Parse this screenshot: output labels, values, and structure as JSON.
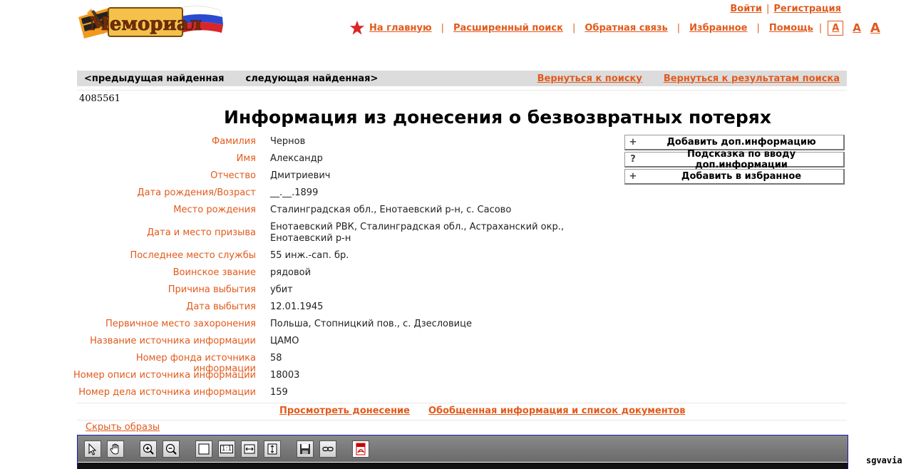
{
  "header": {
    "logo_text": "Мемориал",
    "auth": {
      "login": "Войти",
      "register": "Регистрация",
      "sep": "|"
    },
    "nav": [
      {
        "label": "На главную"
      },
      {
        "label": "Расширенный поиск"
      },
      {
        "label": "Обратная связь"
      },
      {
        "label": "Избранное"
      },
      {
        "label": "Помощь"
      }
    ],
    "nav_sep": "|",
    "font_sizes": [
      "А",
      "А",
      "А"
    ]
  },
  "navbar": {
    "prev": "<предыдущая найденная",
    "next": "следующая найденная>",
    "back_to_search": "Вернуться к поиску",
    "back_to_results": "Вернуться к результатам поиска"
  },
  "record_id": "4085561",
  "title": "Информация из донесения о безвозвратных потерях",
  "fields": [
    {
      "label": "Фамилия",
      "value": "Чернов"
    },
    {
      "label": "Имя",
      "value": "Александр"
    },
    {
      "label": "Отчество",
      "value": "Дмитриевич"
    },
    {
      "label": "Дата рождения/Возраст",
      "value": "__.__.1899"
    },
    {
      "label": "Место рождения",
      "value": "Сталинградская обл., Енотаевский р-н, с. Сасово"
    },
    {
      "label": "Дата и место призыва",
      "value": "Енотаевский РВК, Сталинградская обл., Астраханский окр., Енотаевский р-н"
    },
    {
      "label": "Последнее место службы",
      "value": "55 инж.-сап. бр."
    },
    {
      "label": "Воинское звание",
      "value": "рядовой"
    },
    {
      "label": "Причина выбытия",
      "value": "убит"
    },
    {
      "label": "Дата выбытия",
      "value": "12.01.1945"
    },
    {
      "label": "Первичное место захоронения",
      "value": "Польша, Стопницкий пов., с. Дзесловице"
    },
    {
      "label": "Название источника информации",
      "value": "ЦАМО"
    },
    {
      "label": "Номер фонда источника информации",
      "value": "58"
    },
    {
      "label": "Номер описи источника информации",
      "value": "18003"
    },
    {
      "label": "Номер дела источника информации",
      "value": "159"
    }
  ],
  "side_buttons": [
    {
      "icon": "+",
      "label": "Добавить доп.информацию"
    },
    {
      "icon": "?",
      "label": "Подсказка по вводу доп.информации"
    },
    {
      "icon": "+",
      "label": "Добавить в избранное"
    }
  ],
  "bottom_links": {
    "view_report": "Просмотреть донесение",
    "summary": "Обобщенная информация и список документов"
  },
  "hide_images": "Скрыть образы",
  "viewer_toolbar": [
    "pointer-icon",
    "hand-icon",
    "zoom-in-icon",
    "zoom-out-icon",
    "fit-page-icon",
    "actual-size-icon",
    "fit-width-icon",
    "fit-height-icon",
    "save-icon",
    "link-icon",
    "pdf-icon"
  ],
  "viewer_labels": {
    "actual_size": "1:1",
    "pdf": "PDF"
  },
  "watermark": "sgvavia",
  "colors": {
    "accent": "#e25a1c",
    "bar": "#dcdcdc",
    "viewer_border": "#1a1aa8"
  }
}
